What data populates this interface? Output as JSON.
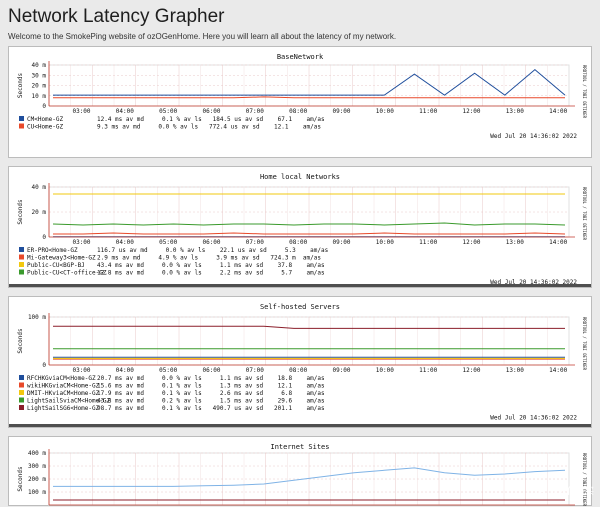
{
  "page": {
    "title": "Network Latency Grapher",
    "subtitle": "Welcome to the SmokePing website of ozOGenHome. Here you will learn all about the latency of my network."
  },
  "chart_data": [
    {
      "type": "line",
      "title": "BaseNetwork",
      "ylabel": "Seconds",
      "ylim": [
        0,
        45
      ],
      "yticks": [
        "40 m",
        "30 m",
        "20 m",
        "10 m",
        "0"
      ],
      "xticks": [
        "03:00",
        "04:00",
        "05:00",
        "06:00",
        "07:00",
        "08:00",
        "09:00",
        "10:00",
        "11:00",
        "12:00",
        "13:00",
        "14:00"
      ],
      "side_label": "RRDTOOL / TOBI OETIKER",
      "grid": true,
      "series": [
        {
          "name": "CM<Home-GZ",
          "color": "#1f4e9c",
          "stats": "12.4 ms av md     0.1 % av ls   184.5 us av sd    67.1    am/as",
          "values": [
            12,
            12,
            12,
            12,
            12,
            12,
            12,
            12,
            12,
            12,
            12,
            12,
            35,
            12,
            36,
            12,
            40,
            12
          ]
        },
        {
          "name": "CU<Home-GZ",
          "color": "#e8492a",
          "stats": "9.3 ms av md     0.0 % av ls   772.4 us av sd    12.1    am/as",
          "values": [
            9,
            9,
            9,
            9,
            9,
            9,
            9,
            10,
            9,
            9,
            9,
            9,
            9,
            9,
            9,
            9,
            9,
            9
          ]
        }
      ],
      "timestamp": "Wed Jul 20 14:36:02 2022"
    },
    {
      "type": "line",
      "title": "Home local Networks",
      "ylabel": "Seconds",
      "ylim": [
        0,
        50
      ],
      "yticks": [
        "40 m",
        "20 m",
        "0"
      ],
      "xticks": [
        "03:00",
        "04:00",
        "05:00",
        "06:00",
        "07:00",
        "08:00",
        "09:00",
        "10:00",
        "11:00",
        "12:00",
        "13:00",
        "14:00"
      ],
      "side_label": "RRDTOOL / TOBI OETIKER",
      "grid": true,
      "series": [
        {
          "name": "ER-PRO<Home-GZ",
          "color": "#1f4e9c",
          "stats": "116.7 us av md     0.0 % av ls    22.1 us av sd     5.3    am/as",
          "values": [
            0.2,
            0.2,
            0.2,
            0.2,
            0.2,
            0.2,
            0.2,
            0.2,
            0.2,
            0.2,
            0.2,
            0.2,
            0.2,
            0.2,
            0.2,
            0.2,
            0.2,
            0.2
          ]
        },
        {
          "name": "Mi-Gateway3<Home-GZ",
          "color": "#e8492a",
          "stats": "2.9 ms av md     4.9 % av ls     3.9 ms av sd   724.3 m  am/as",
          "values": [
            3,
            3,
            4,
            3,
            3,
            3,
            4,
            3,
            3,
            3,
            3,
            4,
            3,
            3,
            3,
            3,
            4,
            3
          ]
        },
        {
          "name": "Public-CU<BGP-BJ",
          "color": "#f2c80f",
          "stats": "43.4 ms av md     0.0 % av ls     1.1 ms av sd    37.8    am/as",
          "values": [
            43,
            43,
            43,
            43,
            43,
            43,
            43,
            43,
            43,
            43,
            43,
            43,
            43,
            43,
            43,
            43,
            43,
            43
          ]
        },
        {
          "name": "Public-CU<CT-office-GZ",
          "color": "#3a9a2c",
          "stats": "12.8 ms av md     0.0 % av ls     2.2 ms av sd     5.7    am/as",
          "values": [
            13,
            12,
            13,
            12,
            13,
            12,
            13,
            13,
            12,
            13,
            13,
            12,
            13,
            14,
            12,
            13,
            13,
            12
          ]
        }
      ],
      "timestamp": "Wed Jul 20 14:36:02 2022"
    },
    {
      "type": "line",
      "title": "Self-hosted Servers",
      "ylabel": "Seconds",
      "ylim": [
        0,
        130
      ],
      "yticks": [
        "100 m",
        "0"
      ],
      "xticks": [
        "03:00",
        "04:00",
        "05:00",
        "06:00",
        "07:00",
        "08:00",
        "09:00",
        "10:00",
        "11:00",
        "12:00",
        "13:00",
        "14:00"
      ],
      "side_label": "RRDTOOL / TOBI OETIKER",
      "grid": true,
      "series": [
        {
          "name": "RFCHKGviaCM<Home-GZ",
          "color": "#1f4e9c",
          "stats": "20.7 ms av md     0.0 % av ls     1.1 ms av sd    18.8    am/as",
          "values": [
            21,
            21,
            21,
            21,
            21,
            21,
            21,
            21,
            21,
            21,
            21,
            21,
            21,
            21,
            21,
            21,
            21,
            21
          ]
        },
        {
          "name": "wikiHKGviaCM<Home-GZ",
          "color": "#e8492a",
          "stats": "15.6 ms av md     0.1 % av ls     1.3 ms av sd    12.1    am/as",
          "values": [
            16,
            16,
            16,
            16,
            16,
            16,
            16,
            16,
            16,
            16,
            16,
            16,
            16,
            16,
            16,
            16,
            16,
            16
          ]
        },
        {
          "name": "DMIT-HKviaCM<Home-GZ",
          "color": "#f2c80f",
          "stats": "17.9 ms av md     0.1 % av ls     2.6 ms av sd     6.8    am/as",
          "values": [
            18,
            18,
            18,
            18,
            18,
            18,
            18,
            18,
            18,
            18,
            18,
            18,
            18,
            18,
            18,
            18,
            18,
            18
          ]
        },
        {
          "name": "LightSailSviaCM<Home-GZ",
          "color": "#3a9a2c",
          "stats": "43.8 ms av md     0.2 % av ls     1.5 ms av sd    29.6    am/as",
          "values": [
            44,
            44,
            44,
            44,
            44,
            44,
            44,
            44,
            44,
            44,
            44,
            44,
            44,
            44,
            44,
            44,
            44,
            44
          ]
        },
        {
          "name": "LightSailSG6<Home-GZ",
          "color": "#8b1e2a",
          "stats": "98.7 ms av md     0.1 % av ls   490.7 us av sd   201.1    am/as",
          "values": [
            105,
            105,
            105,
            105,
            105,
            105,
            105,
            105,
            99,
            99,
            99,
            99,
            99,
            99,
            99,
            99,
            99,
            99
          ]
        }
      ],
      "timestamp": "Wed Jul 20 14:36:02 2022"
    },
    {
      "type": "line",
      "title": "Internet Sites",
      "ylabel": "Seconds",
      "ylim": [
        0,
        420
      ],
      "yticks": [
        "400 m",
        "300 m",
        "200 m",
        "100 m"
      ],
      "side_label": "RRDTOOL / TOBI OETIKER",
      "grid": true,
      "series": [
        {
          "name": "",
          "color": "#7fb3e6",
          "values": [
            150,
            150,
            150,
            150,
            150,
            155,
            160,
            170,
            200,
            230,
            260,
            280,
            300,
            260,
            240,
            250,
            270,
            280
          ]
        },
        {
          "name": "",
          "color": "#8b1e2a",
          "values": [
            40,
            40,
            40,
            40,
            40,
            40,
            40,
            40,
            40,
            40,
            40,
            40,
            40,
            40,
            40,
            40,
            40,
            40
          ]
        }
      ]
    }
  ],
  "watermark": {
    "text": "值 什么值得买"
  }
}
